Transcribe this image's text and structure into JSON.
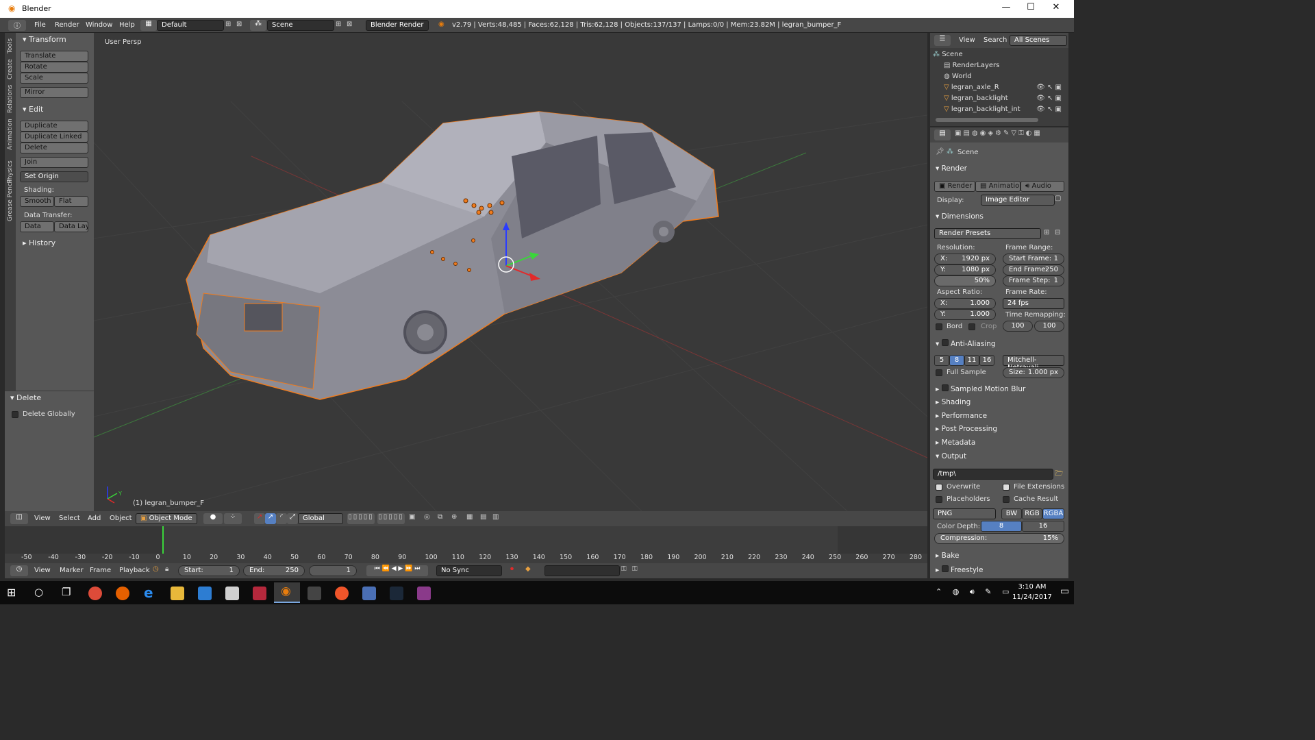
{
  "window": {
    "title": "Blender",
    "min": "—",
    "max": "☐",
    "close": "✕"
  },
  "topbar": {
    "menus": [
      "File",
      "Render",
      "Window",
      "Help"
    ],
    "layout": "Default",
    "scene": "Scene",
    "engine": "Blender Render",
    "stats": "v2.79 | Verts:48,485 | Faces:62,128 | Tris:62,128 | Objects:137/137 | Lamps:0/0 | Mem:23.82M | legran_bumper_F"
  },
  "tool_tabs": [
    "Tools",
    "Create",
    "Relations",
    "Animation",
    "Physics",
    "Grease Pencil"
  ],
  "tools": {
    "transform_hdr": "Transform",
    "translate": "Translate",
    "rotate": "Rotate",
    "scale": "Scale",
    "mirror": "Mirror",
    "edit_hdr": "Edit",
    "duplicate": "Duplicate",
    "duplicate_linked": "Duplicate Linked",
    "delete": "Delete",
    "join": "Join",
    "set_origin": "Set Origin",
    "shading_lbl": "Shading:",
    "smooth": "Smooth",
    "flat": "Flat",
    "data_transfer_lbl": "Data Transfer:",
    "data": "Data",
    "data_layo": "Data Layo",
    "history": "History",
    "delete_hdr": "Delete",
    "delete_globally": "Delete Globally"
  },
  "viewport": {
    "view_label": "User Persp",
    "object_label": "(1) legran_bumper_F",
    "axes": "Y"
  },
  "vpheader": {
    "view": "View",
    "select": "Select",
    "add": "Add",
    "object": "Object",
    "mode": "Object Mode",
    "orientation": "Global"
  },
  "timeline": {
    "ticks": [
      "-50",
      "-40",
      "-30",
      "-20",
      "-10",
      "0",
      "10",
      "20",
      "30",
      "40",
      "50",
      "60",
      "70",
      "80",
      "90",
      "100",
      "110",
      "120",
      "130",
      "140",
      "150",
      "160",
      "170",
      "180",
      "190",
      "200",
      "210",
      "220",
      "230",
      "240",
      "250",
      "260",
      "270",
      "280"
    ]
  },
  "tlheader": {
    "view": "View",
    "marker": "Marker",
    "frame": "Frame",
    "playback": "Playback",
    "start": "Start:",
    "start_val": "1",
    "end": "End:",
    "end_val": "250",
    "current": "1",
    "sync": "No Sync"
  },
  "outliner": {
    "view": "View",
    "search": "Search",
    "all_scenes": "All Scenes",
    "items": [
      "Scene",
      "RenderLayers",
      "World",
      "legran_axle_R",
      "legran_backlight",
      "legran_backlight_int"
    ]
  },
  "props": {
    "scene": "Scene",
    "render_hdr": "Render",
    "render_btn": "Render",
    "animation_btn": "Animation",
    "audio_btn": "Audio",
    "display_lbl": "Display:",
    "display_val": "Image Editor",
    "dimensions_hdr": "Dimensions",
    "render_presets": "Render Presets",
    "resolution_lbl": "Resolution:",
    "res_x": "X:",
    "res_x_val": "1920 px",
    "res_y": "Y:",
    "res_y_val": "1080 px",
    "res_pct": "50%",
    "frame_range_lbl": "Frame Range:",
    "start_frame": "Start Frame:",
    "start_frame_val": "1",
    "end_frame": "End Frame:",
    "end_frame_val": "250",
    "frame_step": "Frame Step:",
    "frame_step_val": "1",
    "aspect_lbl": "Aspect Ratio:",
    "asp_x": "X:",
    "asp_x_val": "1.000",
    "asp_y": "Y:",
    "asp_y_val": "1.000",
    "frame_rate_lbl": "Frame Rate:",
    "fps": "24 fps",
    "time_remap_lbl": "Time Remapping:",
    "remap_old": "100",
    "remap_new": "100",
    "bord": "Bord",
    "crop": "Crop",
    "aa_hdr": "Anti-Aliasing",
    "aa_samples": [
      "5",
      "8",
      "11",
      "16"
    ],
    "aa_filter": "Mitchell-Netravali",
    "full_sample": "Full Sample",
    "size": "Size:",
    "size_val": "1.000 px",
    "motion_blur": "Sampled Motion Blur",
    "shading": "Shading",
    "performance": "Performance",
    "post_processing": "Post Processing",
    "metadata": "Metadata",
    "output_hdr": "Output",
    "output_path": "/tmp\\",
    "overwrite": "Overwrite",
    "file_extensions": "File Extensions",
    "placeholders": "Placeholders",
    "cache_result": "Cache Result",
    "format": "PNG",
    "bw": "BW",
    "rgb": "RGB",
    "rgba": "RGBA",
    "color_depth": "Color Depth:",
    "depth8": "8",
    "depth16": "16",
    "compression": "Compression:",
    "compression_val": "15%",
    "bake": "Bake",
    "freestyle": "Freestyle"
  },
  "taskbar": {
    "time": "3:10 AM",
    "date": "11/24/2017"
  },
  "colors": {
    "accent": "#5680c2",
    "selected": "#f07c1e",
    "bg": "#393939"
  }
}
